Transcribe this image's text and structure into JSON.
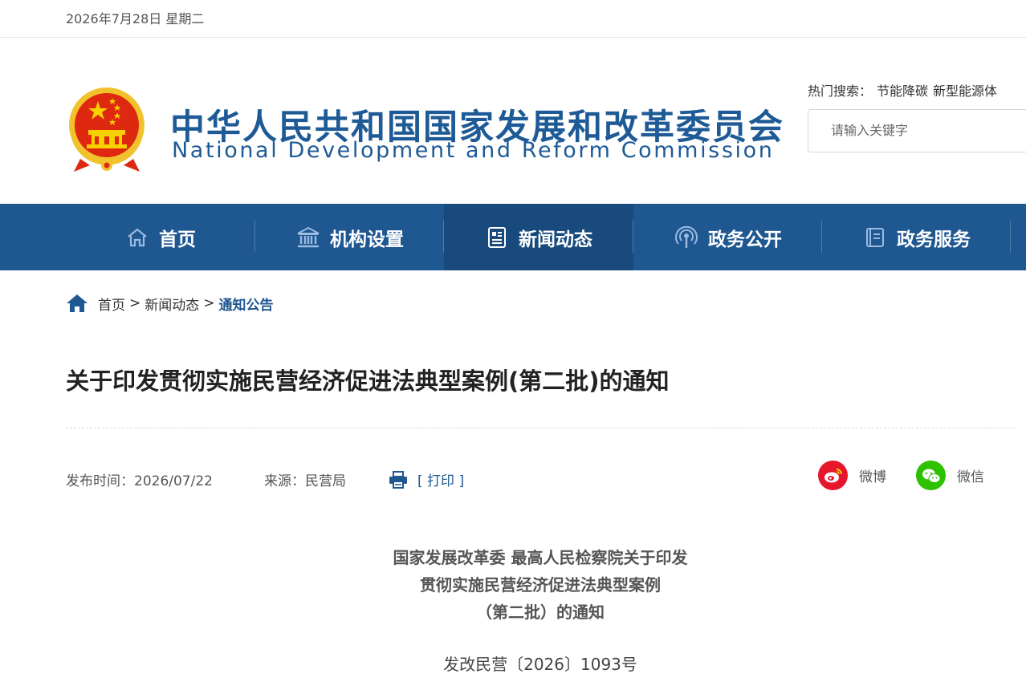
{
  "topbar": {
    "date": "2026年7月28日 星期二"
  },
  "header": {
    "title_cn": "中华人民共和国国家发展和改革委员会",
    "title_en": "National Development and Reform Commission",
    "hot_label": "热门搜索：",
    "hot_terms": [
      "节能降碳",
      "新型能源体"
    ],
    "search_placeholder": "请输入关键字"
  },
  "nav": {
    "items": [
      {
        "label": "首页",
        "icon": "home-icon"
      },
      {
        "label": "机构设置",
        "icon": "institution-icon"
      },
      {
        "label": "新闻动态",
        "icon": "news-icon"
      },
      {
        "label": "政务公开",
        "icon": "broadcast-icon"
      },
      {
        "label": "政务服务",
        "icon": "service-icon"
      }
    ],
    "active_index": 2
  },
  "breadcrumb": {
    "items": [
      "首页",
      "新闻动态",
      "通知公告"
    ],
    "separator": ">"
  },
  "article": {
    "title": "关于印发贯彻实施民营经济促进法典型案例(第二批)的通知",
    "publish_time": "发布时间：2026/07/22",
    "source": "来源：民营局",
    "print_label": "[ 打印 ]",
    "share": {
      "weibo": "微博",
      "wechat": "微信"
    },
    "heading_lines": [
      "国家发展改革委 最高人民检察院关于印发",
      "贯彻实施民营经济促进法典型案例",
      "（第二批）的通知"
    ],
    "doc_number": "发改民营〔2026〕1093号"
  },
  "colors": {
    "primary_blue": "#1f5791",
    "nav_active": "#184a7e",
    "weibo_red": "#e6162d",
    "wechat_green": "#2dc100"
  }
}
